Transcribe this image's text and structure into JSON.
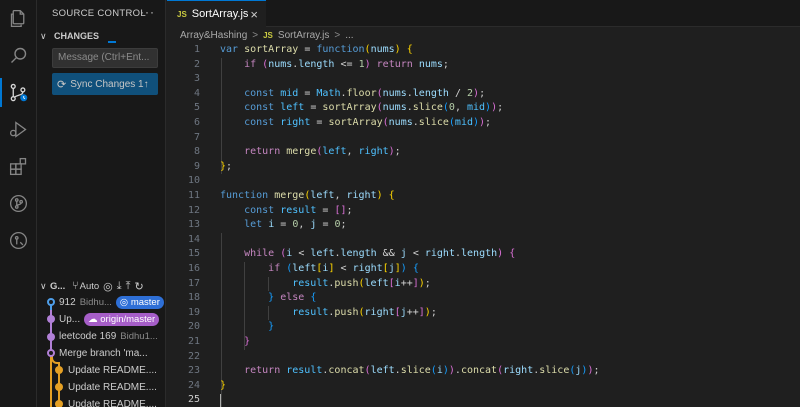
{
  "sidebar": {
    "title": "SOURCE CONTROL",
    "more": "···",
    "changes_label": "CHANGES",
    "message_placeholder": "Message (Ctrl+Ent...",
    "sync_label": "Sync Changes 1↑",
    "graph_label": "G...",
    "graph_auto": "Auto",
    "graph": [
      {
        "title": "912",
        "author": "Bidhu...",
        "badge": "master",
        "badge_color": "#2e6fd6",
        "color": "#4e9ee9"
      },
      {
        "title": "Up...",
        "author": "",
        "badge": "origin/master",
        "badge_color": "#a65ec8",
        "color": "#b180d7"
      },
      {
        "title": "leetcode 169",
        "author": "Bidhu1...",
        "badge": "",
        "color": "#b180d7"
      },
      {
        "title": "Merge branch 'ma...",
        "author": "",
        "badge": "",
        "color": "#b180d7"
      },
      {
        "title": "Update README....",
        "author": "",
        "badge": "",
        "color": "#e5a024"
      },
      {
        "title": "Update README....",
        "author": "",
        "badge": "",
        "color": "#e5a024"
      },
      {
        "title": "Update README....",
        "author": "",
        "badge": "",
        "color": "#e5a024"
      }
    ]
  },
  "editor": {
    "tab": {
      "icon": "JS",
      "name": "SortArray.js",
      "close": "×"
    },
    "breadcrumb": {
      "folder": "Array&Hashing",
      "sep": ">",
      "icon": "JS",
      "file": "SortArray.js",
      "tail": "..."
    },
    "current_line": 25,
    "line_numbers": [
      "1",
      "2",
      "3",
      "4",
      "5",
      "6",
      "7",
      "8",
      "9",
      "10",
      "11",
      "12",
      "13",
      "14",
      "15",
      "16",
      "17",
      "18",
      "19",
      "20",
      "21",
      "22",
      "23",
      "24",
      "25"
    ]
  },
  "colors": {
    "accent": "#0078d4",
    "keyword": "#569cd6",
    "control": "#c586c0",
    "function": "#dcdcaa",
    "variable": "#9cdcfe",
    "constant": "#4fc1ff",
    "number": "#b5cea8"
  }
}
